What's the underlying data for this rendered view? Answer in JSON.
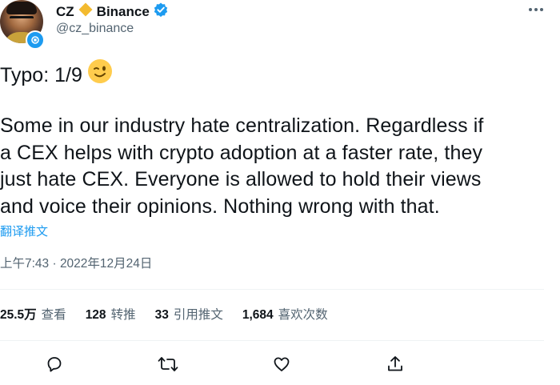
{
  "author": {
    "display_name": "CZ",
    "affiliation": "Binance",
    "handle": "@cz_binance",
    "brand_color": "#f3ba2f",
    "verified_color": "#1d9bf0"
  },
  "tweet": {
    "first_line": "Typo: 1/9",
    "emoji": "😉",
    "body_lines": [
      "Some in our industry hate centralization. Regardless if",
      "a CEX helps with crypto adoption at a faster rate, they",
      "just hate CEX. Everyone is allowed to hold their views",
      "and voice their opinions. Nothing wrong with that."
    ],
    "translate_label": "翻译推文",
    "timestamp": "上午7:43 · 2022年12月24日"
  },
  "stats": {
    "views": {
      "value": "25.5万",
      "label": "查看"
    },
    "retweets": {
      "value": "128",
      "label": "转推"
    },
    "quotes": {
      "value": "33",
      "label": "引用推文"
    },
    "likes": {
      "value": "1,684",
      "label": "喜欢次数"
    }
  },
  "actions": [
    "reply-icon",
    "retweet-icon",
    "like-icon",
    "share-icon"
  ],
  "colors": {
    "text": "#0f1419",
    "secondary": "#536471",
    "link": "#1d9bf0",
    "divider": "#eff3f4"
  }
}
